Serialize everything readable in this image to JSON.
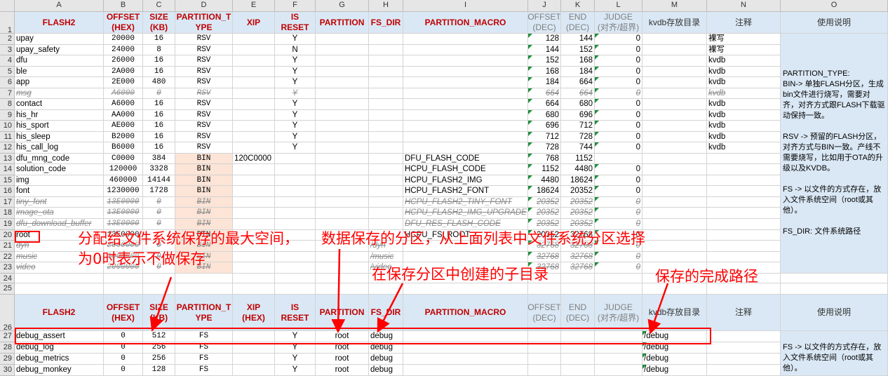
{
  "columns": [
    "A",
    "B",
    "C",
    "D",
    "E",
    "F",
    "G",
    "H",
    "I",
    "J",
    "K",
    "L",
    "M",
    "N",
    "O"
  ],
  "table1": {
    "header_row": "1",
    "headers": [
      "FLASH2",
      "OFFSET\n(HEX)",
      "SIZE\n(KB)",
      "PARTITION_T\nYPE",
      "XIP",
      "IS RESET",
      "PARTITION",
      "FS_DIR",
      "PARTITION_MACRO",
      "OFFSET\n(DEC)",
      "END\n(DEC)",
      "JUDGE\n(对齐/超界)",
      "kvdb存放目录",
      "注释",
      "使用说明"
    ],
    "rows": [
      {
        "num": "2",
        "name": "upay",
        "offset": "20000",
        "size": "16",
        "type": "RSV",
        "xip": "",
        "reset": "Y",
        "part": "",
        "fsdir": "",
        "macro": "",
        "odec": "128",
        "end": "144",
        "judge": "0",
        "kvdb": "",
        "note": "裸写"
      },
      {
        "num": "3",
        "name": "upay_safety",
        "offset": "24000",
        "size": "8",
        "type": "RSV",
        "xip": "",
        "reset": "N",
        "part": "",
        "fsdir": "",
        "macro": "",
        "odec": "144",
        "end": "152",
        "judge": "0",
        "kvdb": "",
        "note": "裸写"
      },
      {
        "num": "4",
        "name": "dfu",
        "offset": "26000",
        "size": "16",
        "type": "RSV",
        "xip": "",
        "reset": "Y",
        "part": "",
        "fsdir": "",
        "macro": "",
        "odec": "152",
        "end": "168",
        "judge": "0",
        "kvdb": "",
        "note": "kvdb"
      },
      {
        "num": "5",
        "name": "ble",
        "offset": "2A000",
        "size": "16",
        "type": "RSV",
        "xip": "",
        "reset": "Y",
        "part": "",
        "fsdir": "",
        "macro": "",
        "odec": "168",
        "end": "184",
        "judge": "0",
        "kvdb": "",
        "note": "kvdb"
      },
      {
        "num": "6",
        "name": "app",
        "offset": "2E000",
        "size": "480",
        "type": "RSV",
        "xip": "",
        "reset": "Y",
        "part": "",
        "fsdir": "",
        "macro": "",
        "odec": "184",
        "end": "664",
        "judge": "0",
        "kvdb": "",
        "note": "kvdb"
      },
      {
        "num": "7",
        "name": "msg",
        "offset": "A6000",
        "size": "0",
        "type": "RSV",
        "xip": "",
        "reset": "Y",
        "part": "",
        "fsdir": "",
        "macro": "",
        "odec": "664",
        "end": "664",
        "judge": "0",
        "kvdb": "",
        "note": "kvdb",
        "strike": true
      },
      {
        "num": "8",
        "name": "contact",
        "offset": "A6000",
        "size": "16",
        "type": "RSV",
        "xip": "",
        "reset": "Y",
        "part": "",
        "fsdir": "",
        "macro": "",
        "odec": "664",
        "end": "680",
        "judge": "0",
        "kvdb": "",
        "note": "kvdb"
      },
      {
        "num": "9",
        "name": "his_hr",
        "offset": "AA000",
        "size": "16",
        "type": "RSV",
        "xip": "",
        "reset": "Y",
        "part": "",
        "fsdir": "",
        "macro": "",
        "odec": "680",
        "end": "696",
        "judge": "0",
        "kvdb": "",
        "note": "kvdb"
      },
      {
        "num": "10",
        "name": "his_sport",
        "offset": "AE000",
        "size": "16",
        "type": "RSV",
        "xip": "",
        "reset": "Y",
        "part": "",
        "fsdir": "",
        "macro": "",
        "odec": "696",
        "end": "712",
        "judge": "0",
        "kvdb": "",
        "note": "kvdb"
      },
      {
        "num": "11",
        "name": "his_sleep",
        "offset": "B2000",
        "size": "16",
        "type": "RSV",
        "xip": "",
        "reset": "Y",
        "part": "",
        "fsdir": "",
        "macro": "",
        "odec": "712",
        "end": "728",
        "judge": "0",
        "kvdb": "",
        "note": "kvdb"
      },
      {
        "num": "12",
        "name": "his_call_log",
        "offset": "B6000",
        "size": "16",
        "type": "RSV",
        "xip": "",
        "reset": "Y",
        "part": "",
        "fsdir": "",
        "macro": "",
        "odec": "728",
        "end": "744",
        "judge": "0",
        "kvdb": "",
        "note": "kvdb"
      },
      {
        "num": "13",
        "name": "dfu_mng_code",
        "offset": "C0000",
        "size": "384",
        "type": "BIN",
        "xip": "120C0000",
        "reset": "",
        "part": "",
        "fsdir": "",
        "macro": "DFU_FLASH_CODE",
        "odec": "768",
        "end": "1152",
        "judge": "",
        "kvdb": "",
        "note": ""
      },
      {
        "num": "14",
        "name": "solution_code",
        "offset": "120000",
        "size": "3328",
        "type": "BIN",
        "xip": "",
        "reset": "",
        "part": "",
        "fsdir": "",
        "macro": "HCPU_FLASH_CODE",
        "odec": "1152",
        "end": "4480",
        "judge": "0",
        "kvdb": "",
        "note": ""
      },
      {
        "num": "15",
        "name": "img",
        "offset": "460000",
        "size": "14144",
        "type": "BIN",
        "xip": "",
        "reset": "",
        "part": "",
        "fsdir": "",
        "macro": "HCPU_FLASH2_IMG",
        "odec": "4480",
        "end": "18624",
        "judge": "0",
        "kvdb": "",
        "note": ""
      },
      {
        "num": "16",
        "name": "font",
        "offset": "1230000",
        "size": "1728",
        "type": "BIN",
        "xip": "",
        "reset": "",
        "part": "",
        "fsdir": "",
        "macro": "HCPU_FLASH2_FONT",
        "odec": "18624",
        "end": "20352",
        "judge": "0",
        "kvdb": "",
        "note": ""
      },
      {
        "num": "17",
        "name": "tiny_font",
        "offset": "13E0000",
        "size": "0",
        "type": "BIN",
        "xip": "",
        "reset": "",
        "part": "",
        "fsdir": "",
        "macro": "HCPU_FLASH2_TINY_FONT",
        "odec": "20352",
        "end": "20352",
        "judge": "0",
        "kvdb": "",
        "note": "",
        "strike": true
      },
      {
        "num": "18",
        "name": "image_ota",
        "offset": "13E0000",
        "size": "0",
        "type": "BIN",
        "xip": "",
        "reset": "",
        "part": "",
        "fsdir": "",
        "macro": "HCPU_FLASH2_IMG_UPGRADE",
        "odec": "20352",
        "end": "20352",
        "judge": "0",
        "kvdb": "",
        "note": "",
        "strike": true
      },
      {
        "num": "19",
        "name": "dfu_download_buffer",
        "offset": "13E0000",
        "size": "0",
        "type": "BIN",
        "xip": "",
        "reset": "",
        "part": "",
        "fsdir": "",
        "macro": "DFU_RES_FLASH_CODE",
        "odec": "20352",
        "end": "20352",
        "judge": "0",
        "kvdb": "",
        "note": "",
        "strike": true
      },
      {
        "num": "20",
        "name": "root",
        "offset": "13E0000",
        "size": "",
        "type": "BIN",
        "xip": "",
        "reset": "",
        "part": "",
        "fsdir": "",
        "macro": "HCPU_FS_ROOT",
        "odec": "20352",
        "end": "32768",
        "judge": "0",
        "kvdb": "",
        "note": ""
      },
      {
        "num": "21",
        "name": "dyn",
        "offset": "2000000",
        "size": "0",
        "type": "BIN",
        "xip": "",
        "reset": "",
        "part": "",
        "fsdir": "/dyn",
        "macro": "",
        "odec": "32768",
        "end": "32768",
        "judge": "0",
        "kvdb": "",
        "note": "",
        "strike": true
      },
      {
        "num": "22",
        "name": "music",
        "offset": "2000000",
        "size": "0",
        "type": "BIN",
        "xip": "",
        "reset": "",
        "part": "",
        "fsdir": "/music",
        "macro": "",
        "odec": "32768",
        "end": "32768",
        "judge": "0",
        "kvdb": "",
        "note": "",
        "strike": true
      },
      {
        "num": "23",
        "name": "video",
        "offset": "2000000",
        "size": "0",
        "type": "BIN",
        "xip": "",
        "reset": "",
        "part": "",
        "fsdir": "/video",
        "macro": "",
        "odec": "32768",
        "end": "32768",
        "judge": "0",
        "kvdb": "",
        "note": "",
        "strike": true
      }
    ],
    "description": "PARTITION_TYPE:\nBIN-> 单独FLASH分区，生成bin文件进行烧写，需要对齐，对齐方式跟FLASH下载驱动保持一致。\n\nRSV -> 预留的FLASH分区，对齐方式与BIN一致。产线不需要烧写，比如用于OTA的升级以及KVDB。\n\nFS -> 以文件的方式存在，放入文件系统空间（root或其他）。\n\nFS_DIR: 文件系统路径"
  },
  "empty_rows": [
    "24",
    "25"
  ],
  "table2": {
    "header_row": "26",
    "headers": [
      "FLASH2",
      "OFFSET\n(HEX)",
      "SIZE\n(KB)",
      "PARTITION_T\nYPE",
      "XIP\n(HEX)",
      "IS RESET",
      "PARTITION",
      "FS_DIR",
      "PARTITION_MACRO",
      "OFFSET\n(DEC)",
      "END\n(DEC)",
      "JUDGE\n(对齐/超界)",
      "kvdb存放目录",
      "注释",
      "使用说明"
    ],
    "rows": [
      {
        "num": "27",
        "name": "debug_assert",
        "offset": "0",
        "size": "512",
        "type": "FS",
        "reset": "Y",
        "part": "root",
        "fsdir": "debug",
        "kvdb": "/debug"
      },
      {
        "num": "28",
        "name": "debug_log",
        "offset": "0",
        "size": "256",
        "type": "FS",
        "reset": "Y",
        "part": "root",
        "fsdir": "debug",
        "kvdb": "/debug"
      },
      {
        "num": "29",
        "name": "debug_metrics",
        "offset": "0",
        "size": "256",
        "type": "FS",
        "reset": "Y",
        "part": "root",
        "fsdir": "debug",
        "kvdb": "/debug"
      },
      {
        "num": "30",
        "name": "debug_monkey",
        "offset": "0",
        "size": "128",
        "type": "FS",
        "reset": "Y",
        "part": "root",
        "fsdir": "debug",
        "kvdb": "/debug"
      }
    ],
    "description": "FS -> 以文件的方式存在，放入文件系统空间（root或其他）。"
  },
  "annotations": {
    "max_space": "分配给文件系统保存的最大空间，",
    "zero_no_save": "为0时表示不做保存",
    "data_partition": "数据保存的分区，从上面列表中文件系统分区选择",
    "subdir": "在保存分区中创建的子目录",
    "full_path": "保存的完成路径"
  },
  "colors": {
    "annotation": "#ff0000",
    "header_text": "#c00000",
    "header_bg": "#dae8f5",
    "bin_bg": "#fce4d6"
  }
}
